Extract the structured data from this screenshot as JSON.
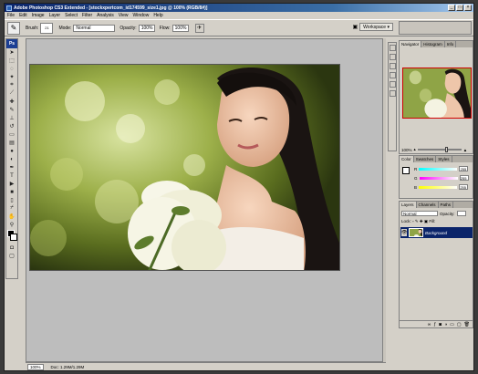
{
  "window": {
    "title": "Adobe Photoshop CS3 Extended - [stockxpertcom_id174599_size1.jpg @ 100% (RGB/8#)]",
    "controls": [
      "_",
      "□",
      "×"
    ]
  },
  "menu": [
    "File",
    "Edit",
    "Image",
    "Layer",
    "Select",
    "Filter",
    "Analysis",
    "View",
    "Window",
    "Help"
  ],
  "options": {
    "brush_label": "Brush:",
    "brush_size": "21",
    "mode_label": "Mode:",
    "mode_value": "Normal",
    "opacity_label": "Opacity:",
    "opacity_value": "100%",
    "flow_label": "Flow:",
    "flow_value": "100%",
    "workspace_label": "Workspace ▾"
  },
  "toolbox": {
    "logo": "Ps",
    "tools": [
      "move-icon",
      "marquee-icon",
      "lasso-icon",
      "magic-wand-icon",
      "crop-icon",
      "slice-icon",
      "healing-icon",
      "brush-icon",
      "stamp-icon",
      "history-brush-icon",
      "eraser-icon",
      "gradient-icon",
      "blur-icon",
      "dodge-icon",
      "pen-icon",
      "type-icon",
      "path-select-icon",
      "shape-icon",
      "notes-icon",
      "eyedropper-icon",
      "hand-icon",
      "zoom-icon"
    ],
    "colors": {
      "foreground": "#000000",
      "background": "#ffffff"
    }
  },
  "status": {
    "zoom": "100%",
    "doc": "Doc: 1.29M/1.29M"
  },
  "navigator": {
    "tabs": [
      "Navigator",
      "Histogram",
      "Info"
    ],
    "zoom": "100%"
  },
  "color_panel": {
    "tabs": [
      "Color",
      "Swatches",
      "Styles"
    ],
    "channels": [
      {
        "label": "R",
        "value": "255"
      },
      {
        "label": "G",
        "value": "255"
      },
      {
        "label": "B",
        "value": "255"
      }
    ]
  },
  "layers_panel": {
    "tabs": [
      "Layers",
      "Channels",
      "Paths"
    ],
    "blend_mode": "Normal",
    "opacity_label": "Opacity:",
    "lock_label": "Lock:",
    "fill_label": "Fill:",
    "layer_name": "Background"
  },
  "colors": {
    "selection": "#0a246a",
    "title_bar": "#0a246a",
    "chrome": "#d4d0c8"
  }
}
